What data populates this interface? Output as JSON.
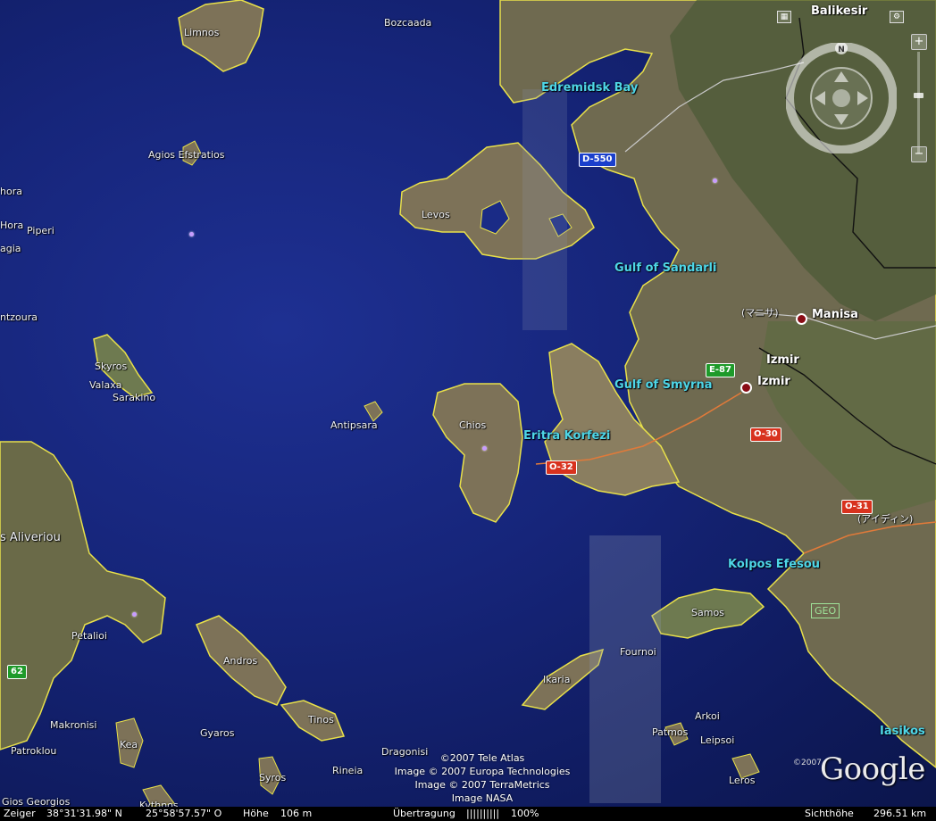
{
  "places": {
    "bozcaada": "Bozcaada",
    "balikesir": "Balikesir",
    "limnos": "Limnos",
    "edremidsk_bay": "Edremidsk Bay",
    "agios_efstratios": "Agios Efstratios",
    "hora_partial": "hora",
    "hora_partial2": "Hora",
    "psiri": "Piperi",
    "agia_partial": "agia",
    "levos": "Levos",
    "gulf_sandarli": "Gulf of Sandarli",
    "zoura_partial": "ntzoura",
    "manisa": "Manisa",
    "manisa_jp": "(マニサ)",
    "izmir_top": "Izmir",
    "izmir": "Izmir",
    "skyros": "Skyros",
    "valaxa": "Valaxa",
    "sarakino": "Sarakino",
    "gulf_smyrna": "Gulf of Smyrna",
    "antipsara": "Antipsara",
    "chios": "Chios",
    "eritra": "Eritra Korfezi",
    "aliveriou": "s Aliveriou",
    "aydin_jp": "(アイディン)",
    "kolpos_efesou": "Kolpos Efesou",
    "samos": "Samos",
    "petalioi": "Petalioi",
    "andros": "Andros",
    "fournoi": "Fournoi",
    "ikaria": "Ikaria",
    "makronisi": "Makronisi",
    "arkoi": "Arkoi",
    "kea": "Kea",
    "gyaros": "Gyaros",
    "tinos": "Tinos",
    "patmos": "Patmos",
    "leipsoi": "Leipsoi",
    "iasikos": "Iasikos",
    "patroklou": "Patroklou",
    "dragonisi": "Dragonisi",
    "rineia": "Rineia",
    "syros": "Syros",
    "leros": "Leros",
    "gios_georgios": "Gios Georgios",
    "kythnos": "Kythnos"
  },
  "roads": {
    "d550": "D-550",
    "e87": "E-87",
    "o30": "O-30",
    "o32": "O-32",
    "o31": "O-31",
    "r62": "62"
  },
  "credits": {
    "line1": "©2007 Tele Atlas",
    "line2": "Image © 2007 Europa Technologies",
    "line3": "Image © 2007 TerraMetrics",
    "line4": "Image NASA"
  },
  "logo": {
    "text": "Google",
    "copyright": "©2007"
  },
  "geo_badge": "GEO",
  "nav": {
    "north": "N"
  },
  "zoom": {
    "plus": "+",
    "minus": "−"
  },
  "status": {
    "pointer_label": "Zeiger",
    "lat": "38°31'31.98\" N",
    "lon": "25°58'57.57\" O",
    "height_label": "Höhe",
    "height": "106 m",
    "streaming_label": "Übertragung",
    "streaming_bar": "||||||||||",
    "streaming_pct": "100%",
    "eye_label": "Sichthöhe",
    "eye": "296.51 km"
  },
  "colors": {
    "sea": "#16257a",
    "land": "#7d7258",
    "coast": "#e8e04a",
    "water_label": "#4ed6e6",
    "route": "#e07a3a"
  }
}
